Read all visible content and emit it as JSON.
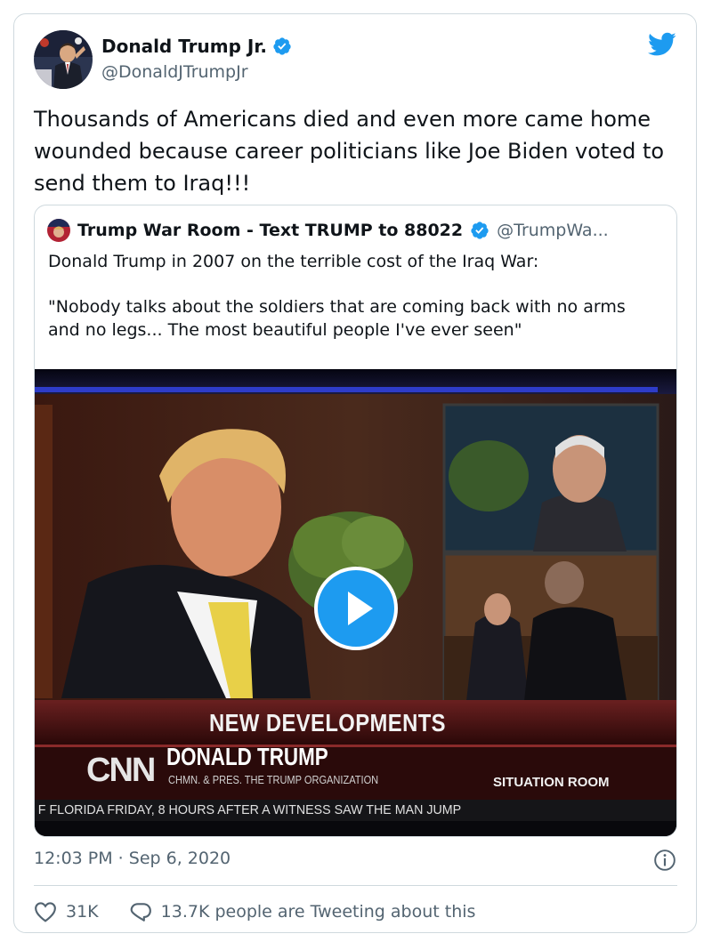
{
  "colors": {
    "accent": "#1d9bf0",
    "muted": "#536471",
    "border": "#cfd9de",
    "text": "#0f1419"
  },
  "tweet": {
    "author_name": "Donald Trump Jr.",
    "author_handle": "@DonaldJTrumpJr",
    "text": "Thousands of Americans died and even more came home wounded because career politicians like Joe Biden voted to send them to Iraq!!!",
    "timestamp": "12:03 PM · Sep 6, 2020",
    "likes": "31K",
    "retweet_text": "13.7K people are Tweeting about this"
  },
  "quote": {
    "author_name": "Trump War Room - Text TRUMP to 88022",
    "author_handle": "@TrumpWa...",
    "line1": "Donald Trump in 2007 on the terrible cost of the Iraq War:",
    "line2": "\"Nobody talks about the soldiers that are coming back with no arms and no legs... The most beautiful people I've ever seen\""
  },
  "video": {
    "headline": "NEW DEVELOPMENTS",
    "network": "CNN",
    "name": "DONALD TRUMP",
    "subtitle": "CHMN. & PRES. THE TRUMP ORGANIZATION",
    "show": "SITUATION ROOM",
    "ticker": "F FLORIDA FRIDAY, 8 HOURS AFTER A WITNESS SAW THE MAN JUMP"
  },
  "icons": {
    "verified": "verified-badge-icon",
    "bird": "twitter-bird-icon",
    "play": "play-icon",
    "info": "info-icon",
    "heart": "heart-icon",
    "reply": "reply-bubble-icon"
  }
}
